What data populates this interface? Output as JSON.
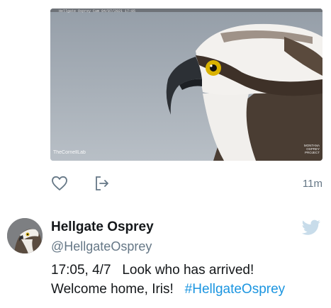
{
  "media": {
    "cam_caption": "Hellgate Osprey Cam  04/07/2021 17:05",
    "watermark_left": "TheCornellLab",
    "watermark_right": "MONTANA OSPREY PROJECT"
  },
  "actions": {
    "timestamp": "11m",
    "icons": [
      "heart-icon",
      "share-icon"
    ]
  },
  "author": {
    "display_name": "Hellgate Osprey",
    "handle": "@HellgateOsprey"
  },
  "tweet": {
    "line1": "17:05, 4/7   Look who has arrived!",
    "line2_text": "Welcome home, Iris!   ",
    "hashtag": "#HellgateOsprey"
  },
  "colors": {
    "link": "#1b95e0",
    "secondary_text": "#657786",
    "twitter_blue_light": "#c8dcea"
  }
}
